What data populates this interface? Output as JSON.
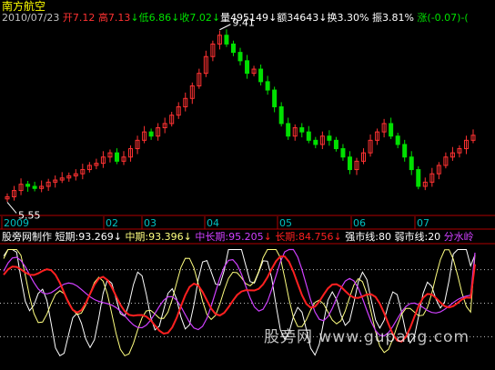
{
  "stock": {
    "name": "南方航空"
  },
  "quote": {
    "date": "2010/07/23",
    "open_label": "开",
    "open": "7.12",
    "high_label": "高",
    "high": "7.13",
    "low_label": "低",
    "low": "6.86",
    "close_label": "收",
    "close": "7.02",
    "volume_label": "量",
    "volume": "495149",
    "amount_label": "额",
    "amount": "34643",
    "turnover_label": "换",
    "turnover": "3.30%",
    "amplitude_label": "振",
    "amplitude": "3.81%",
    "change_label": "涨",
    "change": "(-0.07)-(",
    "down_arrow": "↓"
  },
  "price_chart": {
    "max_label": "9.41",
    "min_label": "5.55",
    "time_labels": [
      "2009",
      "02",
      "03",
      "04",
      "05",
      "06",
      "07"
    ]
  },
  "indicator": {
    "author": "股旁网制作",
    "short_label": "短期:",
    "short_value": "93.269",
    "mid_label": "中期:",
    "mid_value": "93.396",
    "midlong_label": "中长期:",
    "midlong_value": "95.205",
    "long_label": "长期:",
    "long_value": "84.756",
    "strong_label": "强市线:",
    "strong_value": "80",
    "weak_label": "弱市线:",
    "weak_value": "20",
    "water_label": "分水岭"
  },
  "watermark": "股旁网  www.gupang.com",
  "colors": {
    "background": "#000000",
    "up": "#ff3232",
    "down": "#00e000",
    "short_line": "#ffffff",
    "mid_line": "#ffff80",
    "midlong_line": "#d040ff",
    "long_line": "#ff2020",
    "grid": "#b00000"
  },
  "chart_data": [
    {
      "type": "candlestick",
      "title": "南方航空",
      "x_labels": [
        "2009",
        "02",
        "03",
        "04",
        "05",
        "06",
        "07"
      ],
      "series": [
        {
          "values": [
            5.55,
            5.7,
            5.85,
            5.8,
            5.75,
            5.8,
            5.9,
            5.95,
            6.0,
            6.05,
            6.1,
            6.2,
            6.3,
            6.35,
            6.5,
            6.6,
            6.4,
            6.5,
            6.7,
            6.9,
            7.1,
            7.0,
            7.2,
            7.3,
            7.5,
            7.7,
            7.9,
            8.2,
            8.5,
            8.9,
            9.2,
            9.41,
            9.2,
            9.0,
            8.8,
            8.5,
            8.6,
            8.3,
            8.1,
            7.7,
            7.3,
            7.0,
            7.2,
            7.1,
            6.9,
            6.8,
            7.0,
            6.9,
            6.7,
            6.5,
            6.2,
            6.4,
            6.6,
            6.9,
            7.1,
            7.3,
            7.0,
            6.8,
            6.5,
            6.2,
            5.8,
            5.9,
            6.1,
            6.3,
            6.5,
            6.6,
            6.7,
            6.9,
            7.02
          ]
        }
      ],
      "annotations": [
        "9.41",
        "5.55"
      ]
    },
    {
      "type": "line",
      "series": [
        {
          "name": "短期",
          "last": 93.269
        },
        {
          "name": "中期",
          "last": 93.396
        },
        {
          "name": "中长期",
          "last": 95.205
        },
        {
          "name": "长期",
          "last": 84.756
        }
      ],
      "reference_lines": [
        {
          "name": "强市线",
          "value": 80
        },
        {
          "name": "弱市线",
          "value": 20
        },
        {
          "name": "分水岭"
        }
      ],
      "ylim": [
        0,
        100
      ]
    }
  ]
}
